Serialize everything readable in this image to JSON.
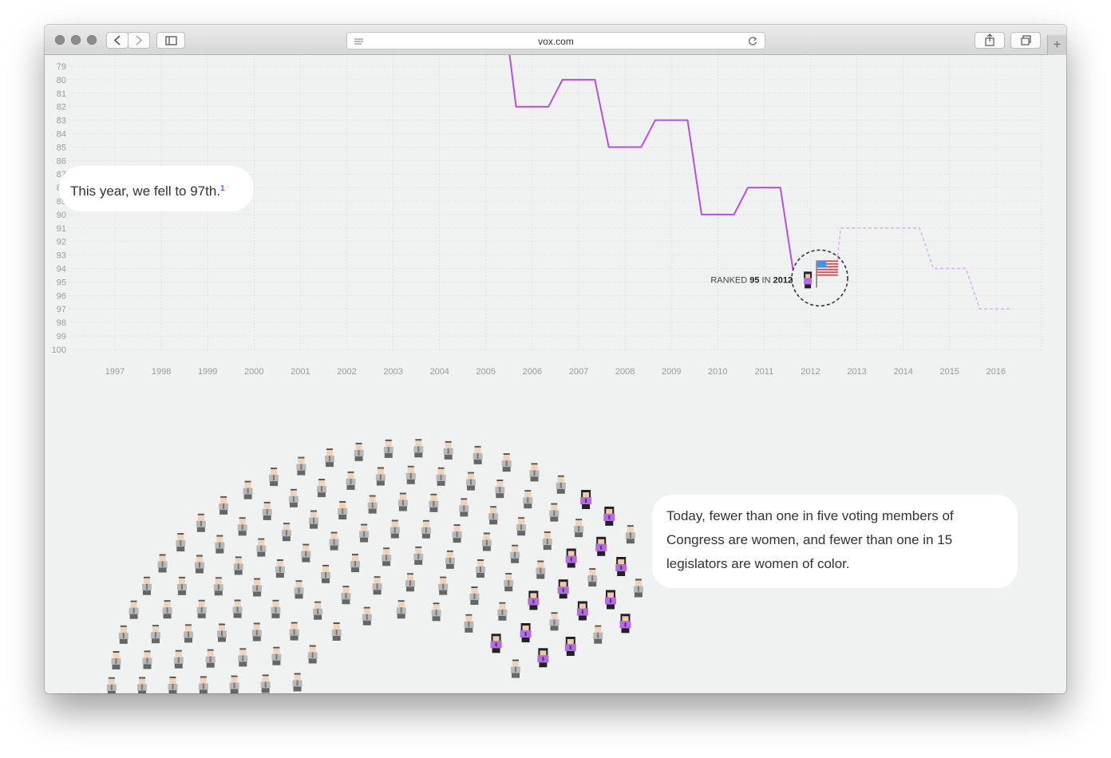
{
  "browser": {
    "url": "vox.com",
    "new_tab_label": "+",
    "icons": [
      "close-window",
      "minimize-window",
      "zoom-window",
      "back",
      "forward",
      "sidebar",
      "reader",
      "reload",
      "share",
      "tabs",
      "new-tab"
    ]
  },
  "chart_data": {
    "type": "line",
    "x": [
      1997,
      1998,
      1999,
      2000,
      2001,
      2002,
      2003,
      2004,
      2005,
      2006,
      2007,
      2008,
      2009,
      2010,
      2011,
      2012,
      2013,
      2014,
      2015,
      2016
    ],
    "x_ticks": [
      "1997",
      "1998",
      "1999",
      "2000",
      "2001",
      "2002",
      "2003",
      "2004",
      "2005",
      "2006",
      "2007",
      "2008",
      "2009",
      "2010",
      "2011",
      "2012",
      "2013",
      "2014",
      "2015",
      "2016"
    ],
    "y_ticks": [
      "79",
      "80",
      "81",
      "82",
      "83",
      "84",
      "85",
      "86",
      "87",
      "88",
      "89",
      "90",
      "91",
      "92",
      "93",
      "94",
      "95",
      "96",
      "97",
      "98",
      "99",
      "100"
    ],
    "y_axis": "rank, inverted (lower rank at top)",
    "ylim": [
      78,
      100
    ],
    "grid": true,
    "series": [
      {
        "style": "solid",
        "color": "#b84fe3",
        "x": [
          2005,
          2006,
          2007,
          2008,
          2009,
          2010,
          2011,
          2012
        ],
        "values": [
          78,
          82,
          80,
          85,
          83,
          90,
          88,
          95
        ]
      },
      {
        "style": "dashed",
        "color": "#d9b2f0",
        "x": [
          2013,
          2014,
          2015,
          2016
        ],
        "values": [
          91,
          91,
          94,
          97
        ]
      }
    ],
    "annotation": {
      "prefix": "RANKED",
      "rank": "95",
      "mid": "IN",
      "year": "2012"
    }
  },
  "callouts": {
    "rank_text": "This year, we fell to 97th.",
    "rank_footnote": "1",
    "congress_text": "Today, fewer than one in five voting members of Congress are women, and fewer than one in 15 legislators are women of color."
  },
  "colors": {
    "accent": "#b84fe3",
    "page_bg": "#f0f1f1",
    "men_figure": "#b8b8b8",
    "women_figure": "#b46be6"
  }
}
